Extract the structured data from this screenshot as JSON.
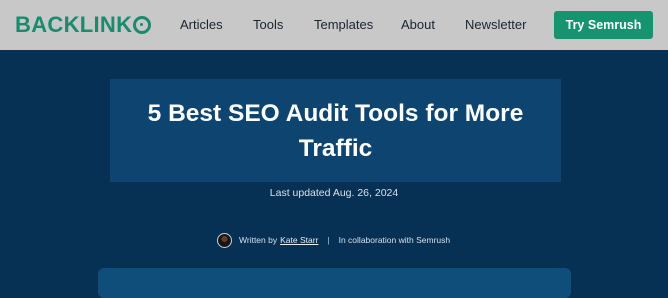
{
  "header": {
    "logo_text": "BACKLINK",
    "logo_icon": "o-ring-icon",
    "nav": [
      "Articles",
      "Tools",
      "Templates",
      "About",
      "Newsletter"
    ],
    "cta_label": "Try Semrush"
  },
  "hero": {
    "title": "5 Best SEO Audit Tools for More Traffic",
    "updated": "Last updated Aug. 26, 2024",
    "byline": {
      "written_by": "Written by",
      "author": "Kate Starr",
      "separator": "|",
      "collab": "In collaboration with Semrush"
    }
  },
  "colors": {
    "brand_green": "#1b8b6e",
    "cta_green": "#16936f",
    "page_bg": "#063155",
    "title_box": "#0e4570",
    "topbar": "#c8c8c8"
  }
}
